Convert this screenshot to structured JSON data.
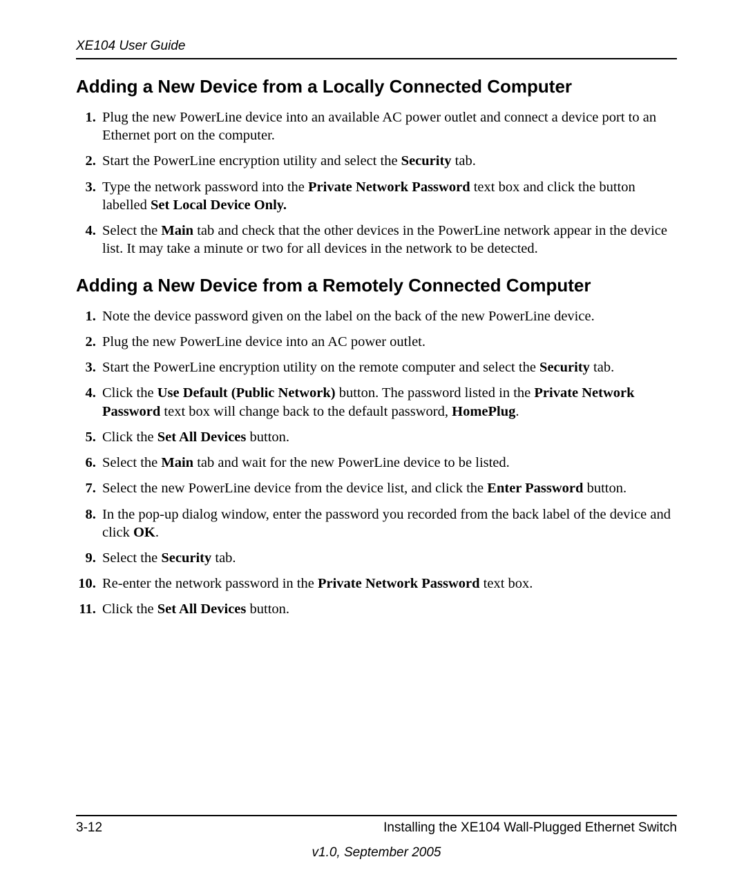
{
  "header": {
    "running_head": "XE104 User Guide"
  },
  "section1": {
    "title": "Adding a New Device from a Locally Connected Computer",
    "steps": [
      {
        "pre": "Plug the new PowerLine device into an available AC power outlet and connect a device port to an Ethernet port on the computer."
      },
      {
        "pre": "Start the PowerLine encryption utility and select the ",
        "b1": "Security",
        "post1": " tab."
      },
      {
        "pre": "Type the network password into the ",
        "b1": "Private Network Password",
        "mid1": " text box and click the button labelled ",
        "b2": "Set Local Device Only."
      },
      {
        "pre": "Select the ",
        "b1": "Main",
        "post1": " tab and check that the other devices in the PowerLine network appear in the device list. It may take a minute or two for all devices in the network to be detected."
      }
    ]
  },
  "section2": {
    "title": "Adding a New Device from a Remotely Connected Computer",
    "steps": [
      {
        "pre": "Note the device password given on the label on the back of the new PowerLine device."
      },
      {
        "pre": "Plug the new PowerLine device into an AC power outlet."
      },
      {
        "pre": "Start the PowerLine encryption utility on the remote computer and select the ",
        "b1": "Security",
        "post1": " tab."
      },
      {
        "pre": "Click the ",
        "b1": "Use Default (Public Network)",
        "mid1": " button. The password listed in the ",
        "b2": "Private Network Password",
        "mid2": " text box will change back to the default password, ",
        "b3": "HomePlug",
        "post3": "."
      },
      {
        "pre": "Click the ",
        "b1": "Set All Devices",
        "post1": " button."
      },
      {
        "pre": "Select the ",
        "b1": "Main",
        "post1": " tab and wait for the new PowerLine device to be listed."
      },
      {
        "pre": "Select the new PowerLine device from the device list, and click the ",
        "b1": "Enter Password",
        "post1": " button."
      },
      {
        "pre": "In the pop-up dialog window, enter the password you recorded from the back label of the device and click ",
        "b1": "OK",
        "post1": "."
      },
      {
        "pre": "Select the ",
        "b1": "Security",
        "post1": " tab."
      },
      {
        "pre": "Re-enter the network password in the ",
        "b1": "Private Network Password",
        "post1": " text box."
      },
      {
        "pre": "Click the ",
        "b1": "Set All Devices",
        "post1": " button."
      }
    ]
  },
  "footer": {
    "page_number": "3-12",
    "chapter": "Installing the XE104 Wall-Plugged Ethernet Switch",
    "version": "v1.0, September 2005"
  }
}
